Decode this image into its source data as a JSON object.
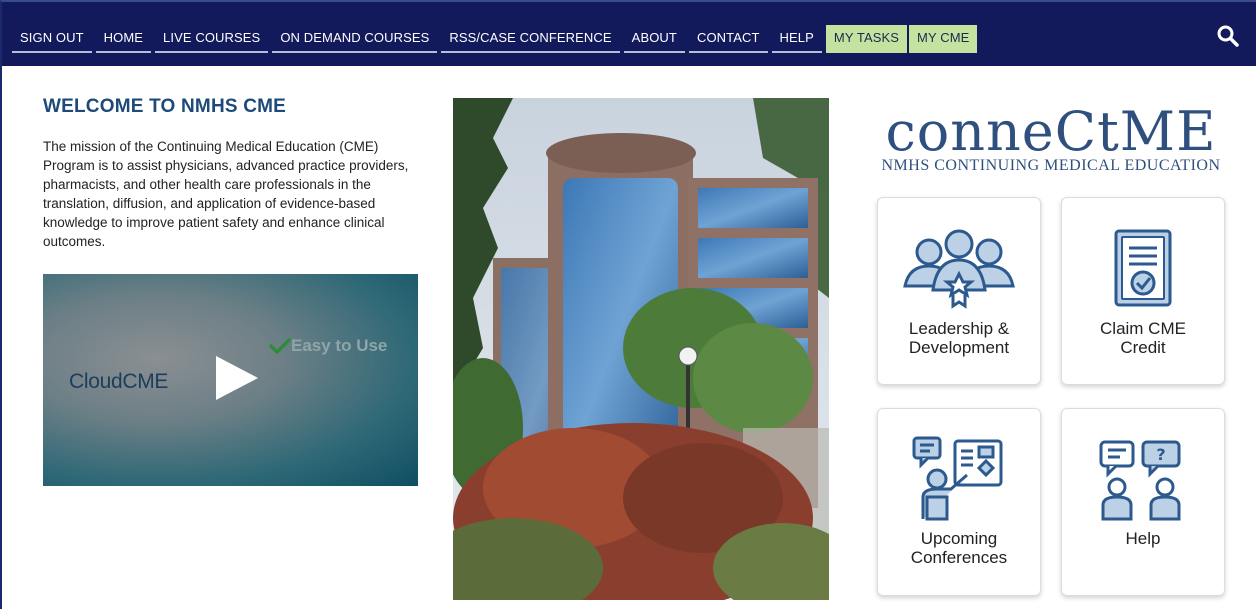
{
  "nav": {
    "items": [
      {
        "label": "SIGN OUT"
      },
      {
        "label": "HOME"
      },
      {
        "label": "LIVE COURSES"
      },
      {
        "label": "ON DEMAND COURSES"
      },
      {
        "label": "RSS/CASE CONFERENCE"
      },
      {
        "label": "ABOUT"
      },
      {
        "label": "CONTACT"
      },
      {
        "label": "HELP"
      }
    ],
    "highlight_items": [
      {
        "label": "MY TASKS"
      },
      {
        "label": "MY CME"
      }
    ],
    "search_icon": "search-icon"
  },
  "welcome": {
    "title": "WELCOME TO NMHS CME",
    "mission": "The mission of the Continuing Medical Education (CME) Program is to assist physicians, advanced practice providers, pharmacists, and other health care professionals in the translation, diffusion, and application of evidence-based knowledge to improve patient safety and enhance clinical outcomes."
  },
  "video": {
    "logo_text": "CloudCME",
    "tagline": "Easy to Use"
  },
  "brand": {
    "logo_text": "conneCtME",
    "subtitle": "NMHS CONTINUING MEDICAL EDUCATION"
  },
  "tiles": [
    {
      "line1": "Leadership &",
      "line2": "Development",
      "icon": "leadership-group-icon"
    },
    {
      "line1": "Claim CME",
      "line2": "Credit",
      "icon": "certificate-icon"
    },
    {
      "line1": "Upcoming",
      "line2": "Conferences",
      "icon": "presentation-icon"
    },
    {
      "line1": "Help",
      "line2": "",
      "icon": "help-chat-icon"
    }
  ],
  "colors": {
    "nav_bg": "#131a5c",
    "nav_highlight": "#c5e3a0",
    "title": "#1d4a7a",
    "brand_blue": "#2f4f7f",
    "icon_blue": "#2d5a8e"
  }
}
